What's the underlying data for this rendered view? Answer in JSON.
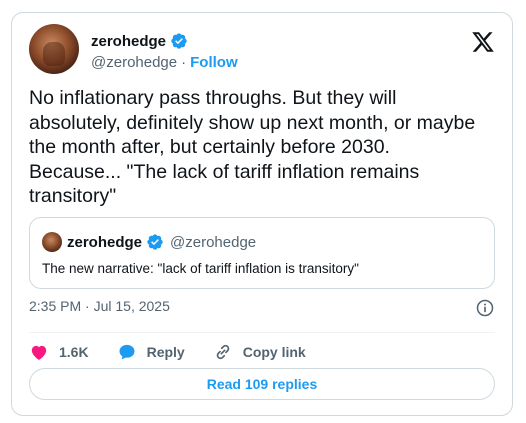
{
  "author": {
    "display_name": "zerohedge",
    "handle": "@zerohedge",
    "separator": "·",
    "follow_label": "Follow"
  },
  "tweet": {
    "text": "No inflationary pass throughs. But they will\nabsolutely, definitely show up next month, or maybe\nthe month after, but certainly before 2030.\nBecause... \"The lack of tariff inflation remains\ntransitory\""
  },
  "quote": {
    "display_name": "zerohedge",
    "handle": "@zerohedge",
    "text": "The new narrative: \"lack of tariff inflation is transitory\""
  },
  "meta": {
    "timestamp": "2:35 PM · Jul 15, 2025"
  },
  "actions": {
    "likes": "1.6K",
    "reply_label": "Reply",
    "copy_link_label": "Copy link"
  },
  "replies_button": {
    "label": "Read 109 replies"
  },
  "colors": {
    "accent": "#1d9bf0",
    "like": "#f91880",
    "muted": "#536471",
    "border": "#cfd9de"
  },
  "icons": [
    "verified-badge-icon",
    "x-logo-icon",
    "info-icon",
    "heart-icon",
    "reply-bubble-icon",
    "link-icon"
  ]
}
